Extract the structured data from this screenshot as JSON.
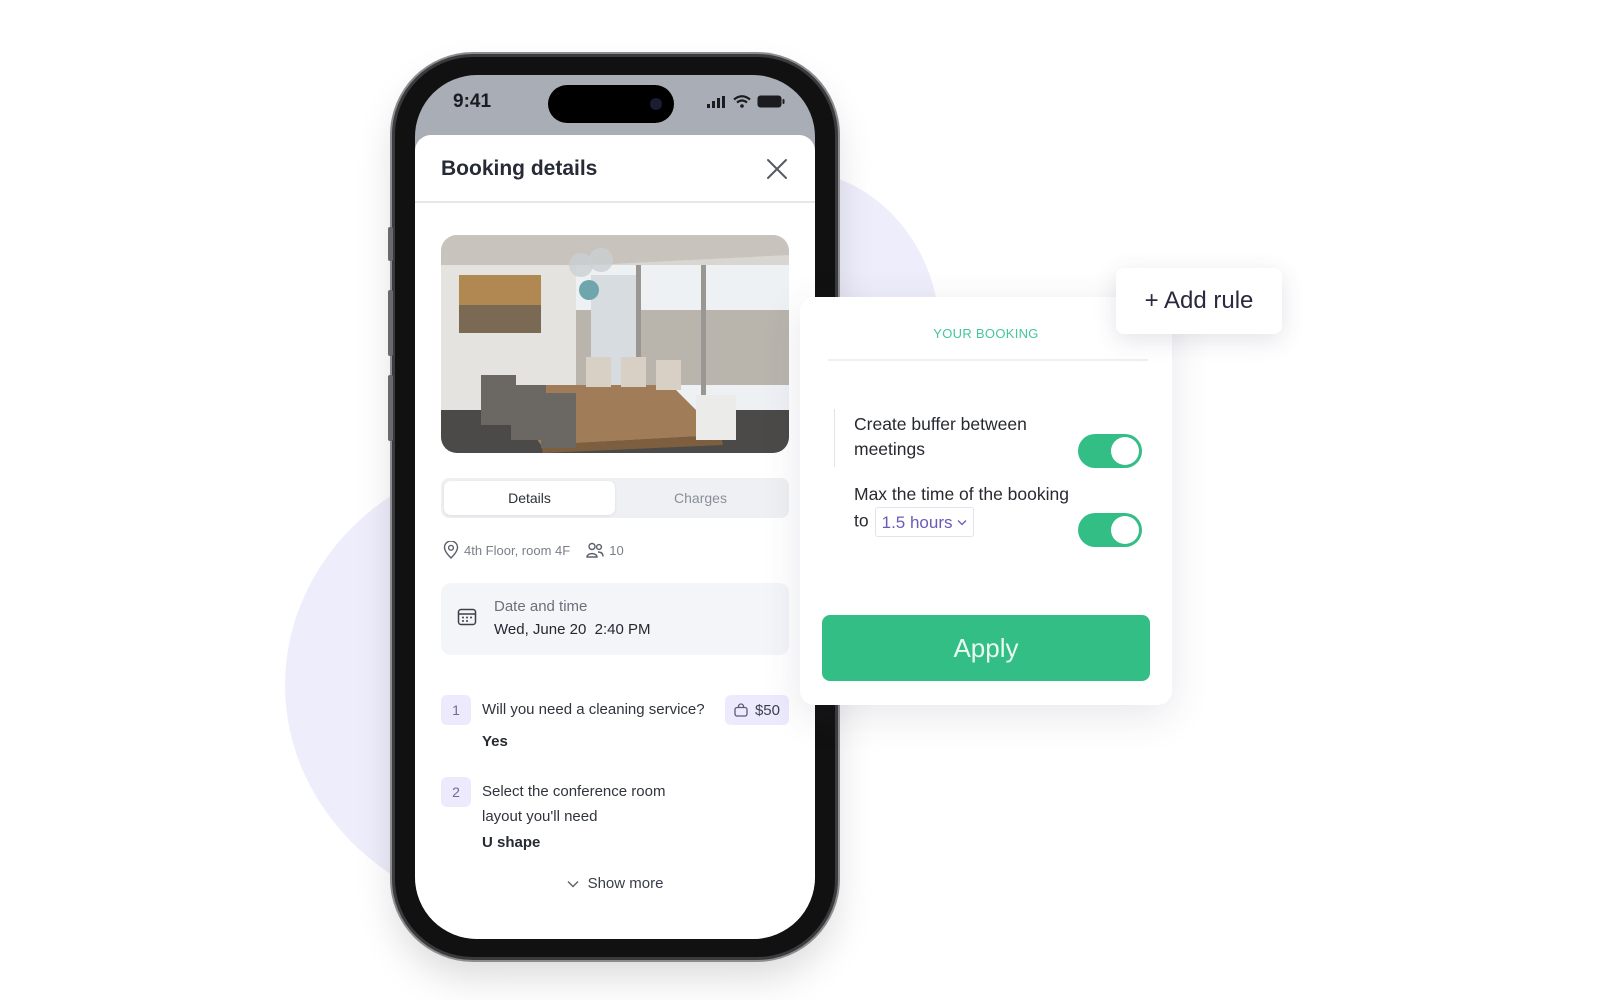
{
  "status_bar": {
    "time": "9:41"
  },
  "sheet": {
    "title": "Booking details",
    "close_icon": "close-icon",
    "image_alt": "Conference room with wooden table and city view",
    "tabs": [
      {
        "label": "Details",
        "active": true
      },
      {
        "label": "Charges",
        "active": false
      }
    ],
    "location": "4th Floor, room 4F",
    "capacity": "10",
    "datetime": {
      "label": "Date and time",
      "value": "Wed, June 20  2:40 PM"
    },
    "questions": [
      {
        "number": "1",
        "text": "Will you need a cleaning service?",
        "answer": "Yes",
        "price": "$50"
      },
      {
        "number": "2",
        "text": "Select the conference room layout you'll need",
        "answer": "U shape"
      }
    ],
    "show_more": "Show more"
  },
  "rules_panel": {
    "title": "YOUR BOOKING",
    "rules": [
      {
        "text": "Create buffer between meetings",
        "enabled": true
      },
      {
        "text_before": "Max the time of the booking to",
        "selected_value": "1.5 hours",
        "enabled": true
      }
    ],
    "apply_label": "Apply"
  },
  "add_rule_label": "+ Add rule",
  "colors": {
    "accent_green": "#33be85",
    "title_green": "#43c898",
    "lavender": "#eeedfb",
    "select_purple": "#6a5bb8"
  }
}
